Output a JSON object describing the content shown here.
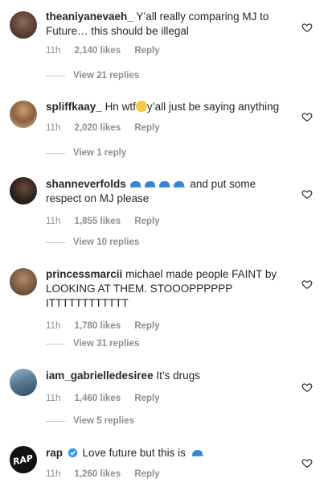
{
  "comments": [
    {
      "username": "theaniyanevaeh_",
      "text": "Y’all really comparing MJ to Future… this should be illegal",
      "time": "11h",
      "likes": "2,140 likes",
      "reply": "Reply",
      "view_replies": "View 21 replies"
    },
    {
      "username": "spliffkaay_",
      "text_before": "Hn wtf",
      "text_after": "y’all just be saying anything",
      "time": "11h",
      "likes": "2,020 likes",
      "reply": "Reply",
      "view_replies": "View 1 reply"
    },
    {
      "username": "shanneverfolds",
      "text": "and put some respect on MJ please",
      "time": "11h",
      "likes": "1,855 likes",
      "reply": "Reply",
      "view_replies": "View 10 replies"
    },
    {
      "username": "princessmarcii",
      "text": "michael made people FAINT by LOOKING AT THEM. STOOOPPPPPP ITTTTTTTTTTTT",
      "time": "11h",
      "likes": "1,780 likes",
      "reply": "Reply",
      "view_replies": "View 31 replies"
    },
    {
      "username": "iam_gabrielledesiree",
      "text": "It’s drugs",
      "time": "11h",
      "likes": "1,460 likes",
      "reply": "Reply",
      "view_replies": "View 5 replies"
    },
    {
      "username": "rap",
      "text": "Love future but this is",
      "time": "11h",
      "likes": "1,260 likes",
      "reply": "Reply",
      "avatar_text": "RAP"
    }
  ],
  "colors": {
    "cap_blue": "#3b82d6",
    "verified_blue": "#3897f0"
  }
}
